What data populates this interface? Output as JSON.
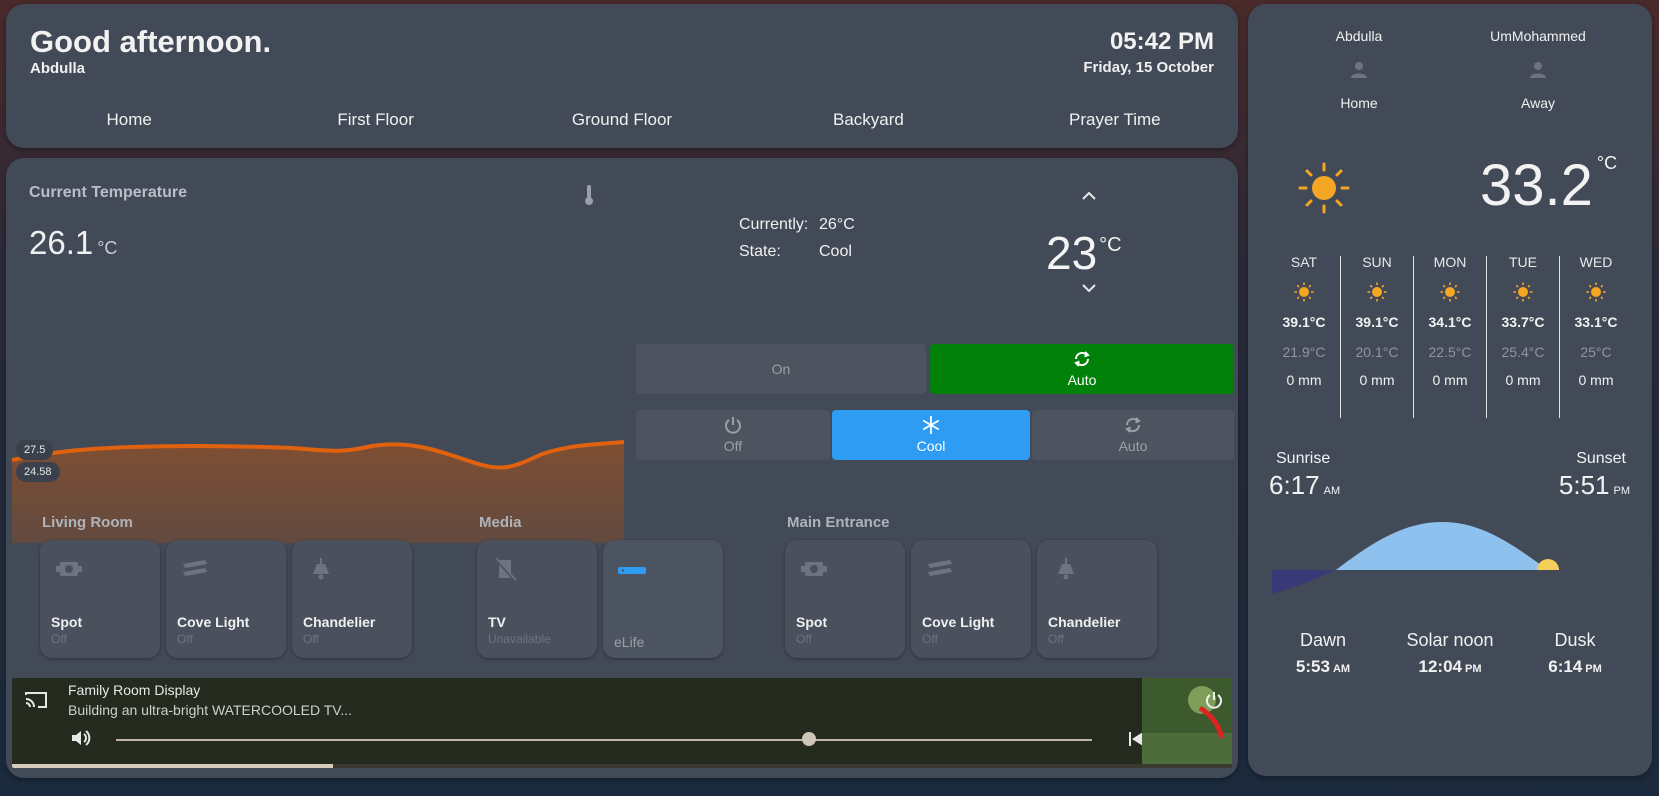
{
  "header": {
    "greeting": "Good afternoon.",
    "user": "Abdulla",
    "time": "05:42 PM",
    "date": "Friday, 15 October",
    "nav": [
      "Home",
      "First Floor",
      "Ground Floor",
      "Backyard",
      "Prayer Time"
    ]
  },
  "temperature": {
    "title": "Current Temperature",
    "value": "26.1",
    "unit": "°C",
    "graph_max_label": "27.5",
    "graph_min_label": "24.58",
    "graph_color": "#e0620f"
  },
  "climate": {
    "currently_label": "Currently:",
    "currently_value": "26°C",
    "state_label": "State:",
    "state_value": "Cool",
    "target": "23",
    "target_unit": "°C",
    "fan_on": "On",
    "fan_auto": "Auto",
    "mode_off": "Off",
    "mode_cool": "Cool",
    "mode_auto": "Auto",
    "active_color": "#2d9cf2",
    "fan_active_color": "#02810a"
  },
  "groups": {
    "living": {
      "title": "Living Room",
      "tiles": [
        {
          "name": "Spot",
          "state": "Off",
          "icon": "spotlight-icon"
        },
        {
          "name": "Cove Light",
          "state": "Off",
          "icon": "led-strip-icon"
        },
        {
          "name": "Chandelier",
          "state": "Off",
          "icon": "ceiling-light-icon"
        }
      ]
    },
    "media": {
      "title": "Media",
      "tiles": [
        {
          "name": "TV",
          "state": "Unavailable",
          "icon": "tv-off-icon"
        },
        {
          "name": "eLife",
          "state": "",
          "icon": "set-top-box-icon"
        }
      ]
    },
    "entrance": {
      "title": "Main Entrance",
      "tiles": [
        {
          "name": "Spot",
          "state": "Off",
          "icon": "spotlight-icon"
        },
        {
          "name": "Cove Light",
          "state": "Off",
          "icon": "led-strip-icon"
        },
        {
          "name": "Chandelier",
          "state": "Off",
          "icon": "ceiling-light-icon"
        }
      ]
    }
  },
  "media_player": {
    "device": "Family Room Display",
    "title": "Building an ultra-bright WATERCOOLED TV...",
    "seek_fraction": 0.71,
    "progress_fraction": 0.263
  },
  "people": [
    {
      "name": "Abdulla",
      "status": "Home"
    },
    {
      "name": "UmMohammed",
      "status": "Away"
    }
  ],
  "weather": {
    "temp": "33.2",
    "unit": "°C",
    "condition_icon": "sunny-icon",
    "forecast": [
      {
        "day": "SAT",
        "hi": "39.1°C",
        "lo": "21.9°C",
        "precip": "0 mm"
      },
      {
        "day": "SUN",
        "hi": "39.1°C",
        "lo": "20.1°C",
        "precip": "0 mm"
      },
      {
        "day": "MON",
        "hi": "34.1°C",
        "lo": "22.5°C",
        "precip": "0 mm"
      },
      {
        "day": "TUE",
        "hi": "33.7°C",
        "lo": "25.4°C",
        "precip": "0 mm"
      },
      {
        "day": "WED",
        "hi": "33.1°C",
        "lo": "25°C",
        "precip": "0 mm"
      }
    ]
  },
  "sun": {
    "sunrise_label": "Sunrise",
    "sunrise": "6:17",
    "sunrise_ampm": "AM",
    "sunset_label": "Sunset",
    "sunset": "5:51",
    "sunset_ampm": "PM",
    "dawn_label": "Dawn",
    "dawn": "5:53",
    "dawn_ampm": "AM",
    "noon_label": "Solar noon",
    "noon": "12:04",
    "noon_ampm": "PM",
    "dusk_label": "Dusk",
    "dusk": "6:14",
    "dusk_ampm": "PM",
    "day_color": "#8fc1ef",
    "night_color": "#3a3a78",
    "sun_color": "#f5cf5a"
  }
}
